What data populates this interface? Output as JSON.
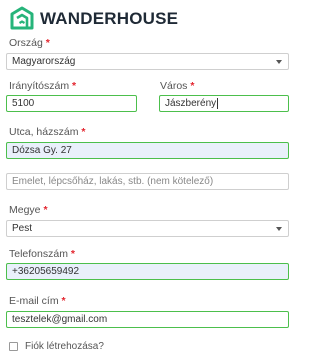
{
  "brand": {
    "name": "WANDERHOUSE",
    "logo_color": "#26b47a"
  },
  "required_marker": "*",
  "country": {
    "label": "Ország",
    "value": "Magyarország"
  },
  "zip": {
    "label": "Irányítószám",
    "value": "5100"
  },
  "city": {
    "label": "Város",
    "value": "Jászberény"
  },
  "street": {
    "label": "Utca, házszám",
    "value": "Dózsa Gy. 27"
  },
  "address2": {
    "placeholder": "Emelet, lépcsőház, lakás, stb. (nem kötelező)"
  },
  "county": {
    "label": "Megye",
    "value": "Pest"
  },
  "phone": {
    "label": "Telefonszám",
    "value": "+36205659492"
  },
  "email": {
    "label": "E-mail cím",
    "value": "tesztelek@gmail.com"
  },
  "create_account": {
    "label": "Fiók létrehozása?",
    "checked": false
  },
  "colors": {
    "required": "#e3262f",
    "valid_border": "#4cbf4c",
    "autofill_bg": "#e9f0fb"
  }
}
